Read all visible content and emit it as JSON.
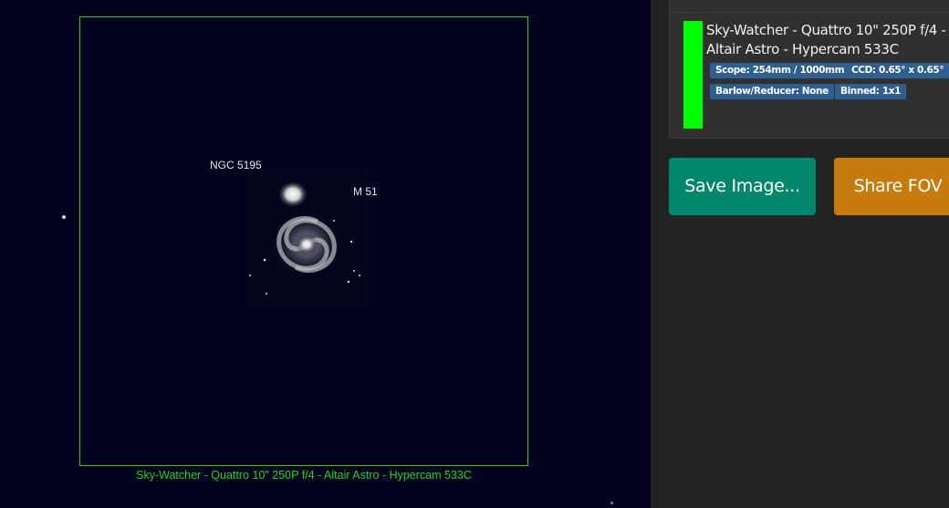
{
  "sky_view": {
    "fov_caption": "Sky-Watcher - Quattro 10\" 250P f/4 - Altair Astro - Hypercam 533C",
    "fov_color": "#1fd21f",
    "objects": [
      {
        "label": "NGC 5195"
      },
      {
        "label": "M 51"
      }
    ]
  },
  "equipment_card": {
    "title": "Sky-Watcher - Quattro 10\" 250P f/4 - Altair Astro - Hypercam 533C",
    "color": "#00ff00",
    "badges": {
      "scope": "Scope: 254mm / 1000mm",
      "ccd": "CCD: 0.65° x 0.65°",
      "barlow": "Barlow/Reducer: None",
      "binned": "Binned: 1x1"
    }
  },
  "actions": {
    "save_label": "Save Image...",
    "share_label": "Share FOV"
  },
  "colors": {
    "save_button": "#00876b",
    "share_button": "#c77b0c",
    "badge": "#2f5f8f",
    "sky_background": "#02021f"
  }
}
